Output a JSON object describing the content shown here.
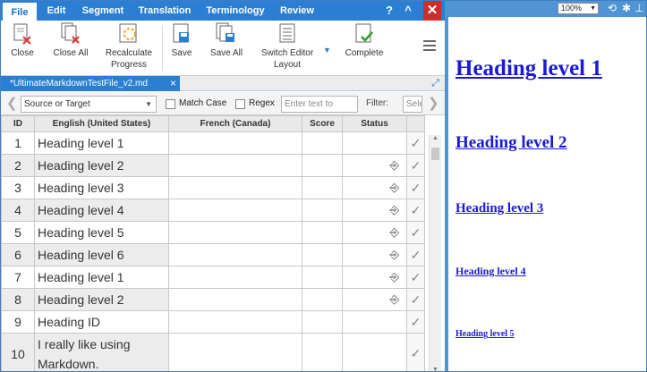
{
  "menu": {
    "items": [
      {
        "label": "File",
        "active": true
      },
      {
        "label": "Edit"
      },
      {
        "label": "Segment"
      },
      {
        "label": "Translation"
      },
      {
        "label": "Terminology"
      },
      {
        "label": "Review"
      }
    ],
    "help_label": "?",
    "collapse_label": "^",
    "close_label": "✕"
  },
  "ribbon": {
    "close": "Close",
    "close_all": "Close All",
    "recalculate": "Recalculate Progress",
    "save": "Save",
    "save_all": "Save All",
    "switch_layout": "Switch Editor Layout",
    "complete": "Complete"
  },
  "tab": {
    "label": "*UltimateMarkdownTestFile_v2.md",
    "close": "×"
  },
  "filter": {
    "scope": "Source or Target",
    "match_case": "Match Case",
    "regex": "Regex",
    "search_placeholder": "Enter text to",
    "filter_label": "Filter:",
    "filter_value": "Sele"
  },
  "grid": {
    "headers": {
      "id": "ID",
      "source": "English (United States)",
      "target": "French (Canada)",
      "score": "Score",
      "status": "Status"
    },
    "rows": [
      {
        "id": "1",
        "source": "Heading level 1",
        "mark": false
      },
      {
        "id": "2",
        "source": "Heading level 2",
        "mark": true
      },
      {
        "id": "3",
        "source": "Heading level 3",
        "mark": true
      },
      {
        "id": "4",
        "source": "Heading level 4",
        "mark": true
      },
      {
        "id": "5",
        "source": "Heading level 5",
        "mark": true
      },
      {
        "id": "6",
        "source": "Heading level 6",
        "mark": true
      },
      {
        "id": "7",
        "source": "Heading level 1",
        "mark": true
      },
      {
        "id": "8",
        "source": "Heading level 2",
        "mark": true
      },
      {
        "id": "9",
        "source": "Heading ID",
        "mark": false
      },
      {
        "id": "10",
        "source": "I really like using Markdown.",
        "mark": false
      }
    ]
  },
  "preview": {
    "zoom": "100%",
    "headings": [
      "Heading level 1",
      "Heading level 2",
      "Heading level 3",
      "Heading level 4",
      "Heading level 5"
    ]
  }
}
